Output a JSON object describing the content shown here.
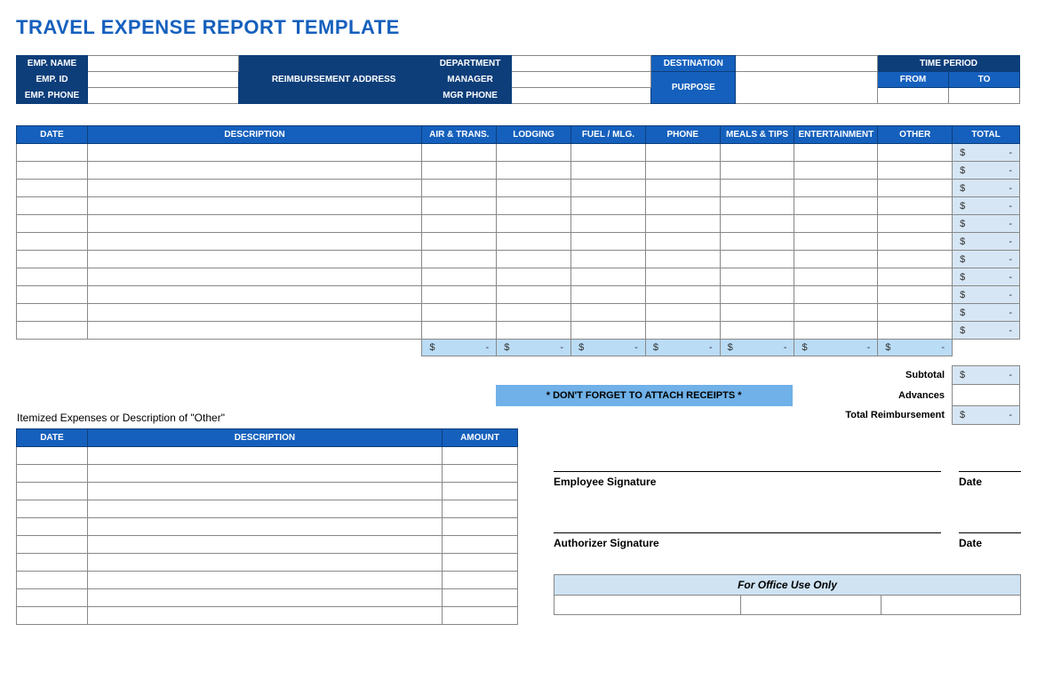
{
  "title": "TRAVEL EXPENSE REPORT TEMPLATE",
  "info": {
    "emp_name": "EMP. NAME",
    "emp_id": "EMP. ID",
    "emp_phone": "EMP. PHONE",
    "reimb_addr": "REIMBURSEMENT ADDRESS",
    "department": "DEPARTMENT",
    "manager": "MANAGER",
    "mgr_phone": "MGR PHONE",
    "destination": "DESTINATION",
    "purpose": "PURPOSE",
    "time_period": "TIME PERIOD",
    "from": "FROM",
    "to": "TO",
    "emp_name_val": "",
    "emp_id_val": "",
    "emp_phone_val": "",
    "reimb_addr_val": "",
    "department_val": "",
    "manager_val": "",
    "mgr_phone_val": "",
    "destination_val": "",
    "purpose_val": "",
    "from_val": "",
    "to_val": ""
  },
  "exp_headers": {
    "date": "DATE",
    "desc": "DESCRIPTION",
    "air": "AIR & TRANS.",
    "lodging": "LODGING",
    "fuel": "FUEL / MLG.",
    "phone": "PHONE",
    "meals": "MEALS & TIPS",
    "ent": "ENTERTAINMENT",
    "other": "OTHER",
    "total": "TOTAL"
  },
  "exp_rows": [
    {
      "date": "",
      "desc": "",
      "air": "",
      "lodging": "",
      "fuel": "",
      "phone": "",
      "meals": "",
      "ent": "",
      "other": "",
      "total": "-"
    },
    {
      "date": "",
      "desc": "",
      "air": "",
      "lodging": "",
      "fuel": "",
      "phone": "",
      "meals": "",
      "ent": "",
      "other": "",
      "total": "-"
    },
    {
      "date": "",
      "desc": "",
      "air": "",
      "lodging": "",
      "fuel": "",
      "phone": "",
      "meals": "",
      "ent": "",
      "other": "",
      "total": "-"
    },
    {
      "date": "",
      "desc": "",
      "air": "",
      "lodging": "",
      "fuel": "",
      "phone": "",
      "meals": "",
      "ent": "",
      "other": "",
      "total": "-"
    },
    {
      "date": "",
      "desc": "",
      "air": "",
      "lodging": "",
      "fuel": "",
      "phone": "",
      "meals": "",
      "ent": "",
      "other": "",
      "total": "-"
    },
    {
      "date": "",
      "desc": "",
      "air": "",
      "lodging": "",
      "fuel": "",
      "phone": "",
      "meals": "",
      "ent": "",
      "other": "",
      "total": "-"
    },
    {
      "date": "",
      "desc": "",
      "air": "",
      "lodging": "",
      "fuel": "",
      "phone": "",
      "meals": "",
      "ent": "",
      "other": "",
      "total": "-"
    },
    {
      "date": "",
      "desc": "",
      "air": "",
      "lodging": "",
      "fuel": "",
      "phone": "",
      "meals": "",
      "ent": "",
      "other": "",
      "total": "-"
    },
    {
      "date": "",
      "desc": "",
      "air": "",
      "lodging": "",
      "fuel": "",
      "phone": "",
      "meals": "",
      "ent": "",
      "other": "",
      "total": "-"
    },
    {
      "date": "",
      "desc": "",
      "air": "",
      "lodging": "",
      "fuel": "",
      "phone": "",
      "meals": "",
      "ent": "",
      "other": "",
      "total": "-"
    },
    {
      "date": "",
      "desc": "",
      "air": "",
      "lodging": "",
      "fuel": "",
      "phone": "",
      "meals": "",
      "ent": "",
      "other": "",
      "total": "-"
    }
  ],
  "col_totals": {
    "air": "-",
    "lodging": "-",
    "fuel": "-",
    "phone": "-",
    "meals": "-",
    "ent": "-",
    "other": "-"
  },
  "summary": {
    "subtotal_label": "Subtotal",
    "subtotal_val": "-",
    "advances_label": "Advances",
    "advances_val": "",
    "total_reimb_label": "Total Reimbursement",
    "total_reimb_val": "-"
  },
  "reminder": "* DON'T FORGET TO ATTACH RECEIPTS *",
  "itemized": {
    "title": "Itemized Expenses or Description of \"Other\"",
    "headers": {
      "date": "DATE",
      "desc": "DESCRIPTION",
      "amount": "AMOUNT"
    },
    "rows": [
      {
        "date": "",
        "desc": "",
        "amount": ""
      },
      {
        "date": "",
        "desc": "",
        "amount": ""
      },
      {
        "date": "",
        "desc": "",
        "amount": ""
      },
      {
        "date": "",
        "desc": "",
        "amount": ""
      },
      {
        "date": "",
        "desc": "",
        "amount": ""
      },
      {
        "date": "",
        "desc": "",
        "amount": ""
      },
      {
        "date": "",
        "desc": "",
        "amount": ""
      },
      {
        "date": "",
        "desc": "",
        "amount": ""
      },
      {
        "date": "",
        "desc": "",
        "amount": ""
      },
      {
        "date": "",
        "desc": "",
        "amount": ""
      }
    ]
  },
  "signatures": {
    "emp_sig": "Employee Signature",
    "auth_sig": "Authorizer Signature",
    "date": "Date"
  },
  "office": {
    "title": "For Office Use Only"
  },
  "currency_symbol": "$"
}
